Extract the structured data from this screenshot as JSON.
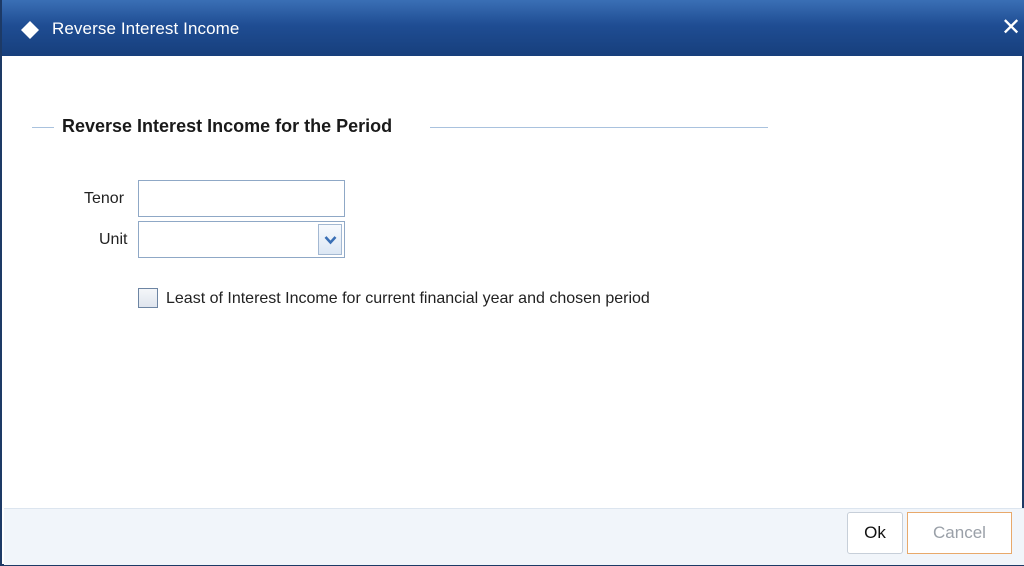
{
  "window": {
    "title": "Reverse Interest Income",
    "close_glyph": "✕"
  },
  "fieldset": {
    "legend": "Reverse Interest Income for the Period"
  },
  "form": {
    "tenor_label": "Tenor",
    "tenor_value": "",
    "unit_label": "Unit",
    "unit_value": "",
    "checkbox_label": "Least of Interest Income for current financial year and chosen period",
    "checkbox_checked": false
  },
  "buttons": {
    "ok_label": "Ok",
    "cancel_label": "Cancel"
  },
  "icons": {
    "title_icon": "diamond-icon",
    "close_icon": "close-icon",
    "dropdown_icon": "chevron-down-icon"
  },
  "colors": {
    "titlebar": "#1f4d93",
    "cancel_border": "#e8a96b",
    "fieldset_line": "#a9c2de",
    "chevron": "#3a6fb5"
  }
}
